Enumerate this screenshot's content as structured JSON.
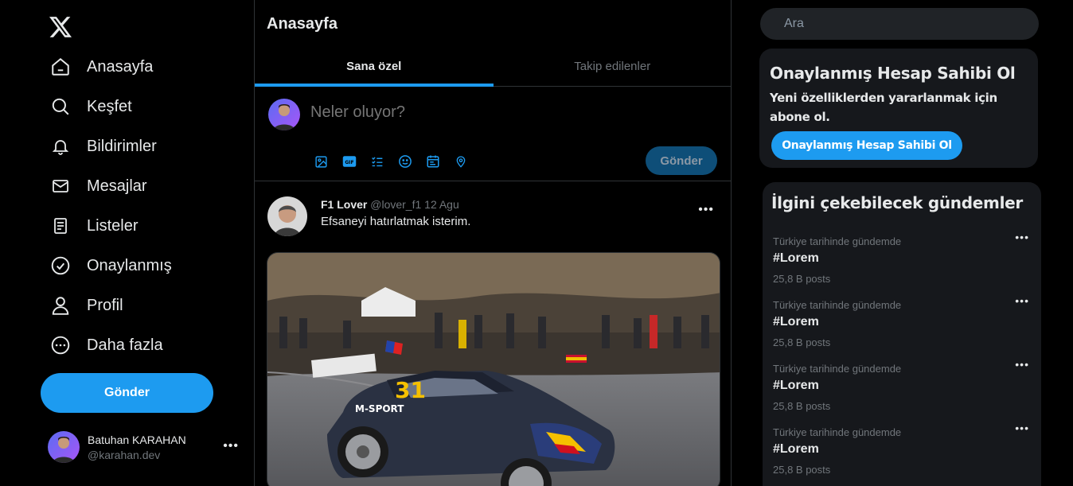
{
  "nav": {
    "items": [
      {
        "label": "Anasayfa",
        "icon": "home-icon"
      },
      {
        "label": "Keşfet",
        "icon": "search-icon"
      },
      {
        "label": "Bildirimler",
        "icon": "bell-icon"
      },
      {
        "label": "Mesajlar",
        "icon": "mail-icon"
      },
      {
        "label": "Listeler",
        "icon": "list-icon"
      },
      {
        "label": "Onaylanmış",
        "icon": "verified-icon"
      },
      {
        "label": "Profil",
        "icon": "user-icon"
      },
      {
        "label": "Daha fazla",
        "icon": "more-circle-icon"
      }
    ],
    "post_button": "Gönder"
  },
  "account": {
    "name": "Batuhan KARAHAN",
    "handle": "@karahan.dev",
    "more": "•••"
  },
  "main": {
    "title": "Anasayfa",
    "tabs": [
      {
        "label": "Sana özel",
        "active": true
      },
      {
        "label": "Takip edilenler",
        "active": false
      }
    ],
    "composer": {
      "placeholder": "Neler oluyor?",
      "send_label": "Gönder",
      "tools": [
        "image-icon",
        "gif-icon",
        "poll-icon",
        "emoji-icon",
        "schedule-icon",
        "location-icon"
      ]
    },
    "tweet": {
      "name": "F1 Lover",
      "meta": " @lover_f1 12 Agu",
      "text": "Efsaneyi hatırlatmak isterim.",
      "more": "•••"
    }
  },
  "right": {
    "search_placeholder": "Ara",
    "premium": {
      "title": "Onaylanmış Hesap Sahibi Ol",
      "desc": "Yeni özelliklerden yararlanmak için abone ol.",
      "button": "Onaylanmış Hesap Sahibi Ol"
    },
    "trends": {
      "title": "İlgini çekebilecek gündemler",
      "items": [
        {
          "context": "Türkiye tarihinde gündemde",
          "tag": "#Lorem",
          "count": "25,8 B posts",
          "more": "•••"
        },
        {
          "context": "Türkiye tarihinde gündemde",
          "tag": "#Lorem",
          "count": "25,8 B posts",
          "more": "•••"
        },
        {
          "context": "Türkiye tarihinde gündemde",
          "tag": "#Lorem",
          "count": "25,8 B posts",
          "more": "•••"
        },
        {
          "context": "Türkiye tarihinde gündemde",
          "tag": "#Lorem",
          "count": "25,8 B posts",
          "more": "•••"
        }
      ]
    }
  },
  "colors": {
    "accent": "#1d9bf0",
    "border": "#2f3336",
    "muted": "#71767b",
    "card": "#16181c"
  }
}
